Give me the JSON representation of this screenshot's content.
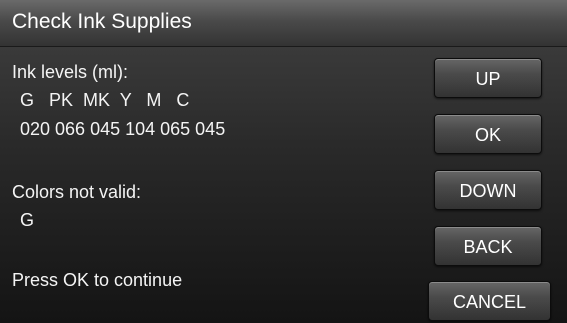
{
  "header": {
    "title": "Check Ink Supplies"
  },
  "ink": {
    "levels_label": "Ink levels (ml):",
    "colors_row": "G   PK  MK  Y   M   C",
    "values_row": "020 066 045 104 065 045"
  },
  "invalid": {
    "label": "Colors not valid:",
    "value": "G"
  },
  "footer": {
    "prompt": "Press OK to continue"
  },
  "buttons": {
    "up": "UP",
    "ok": "OK",
    "down": "DOWN",
    "back": "BACK",
    "cancel": "CANCEL"
  },
  "colors": {
    "background": "#1e1e1e",
    "titlebar": "#4a4a4a",
    "text": "#f2f2f2"
  }
}
